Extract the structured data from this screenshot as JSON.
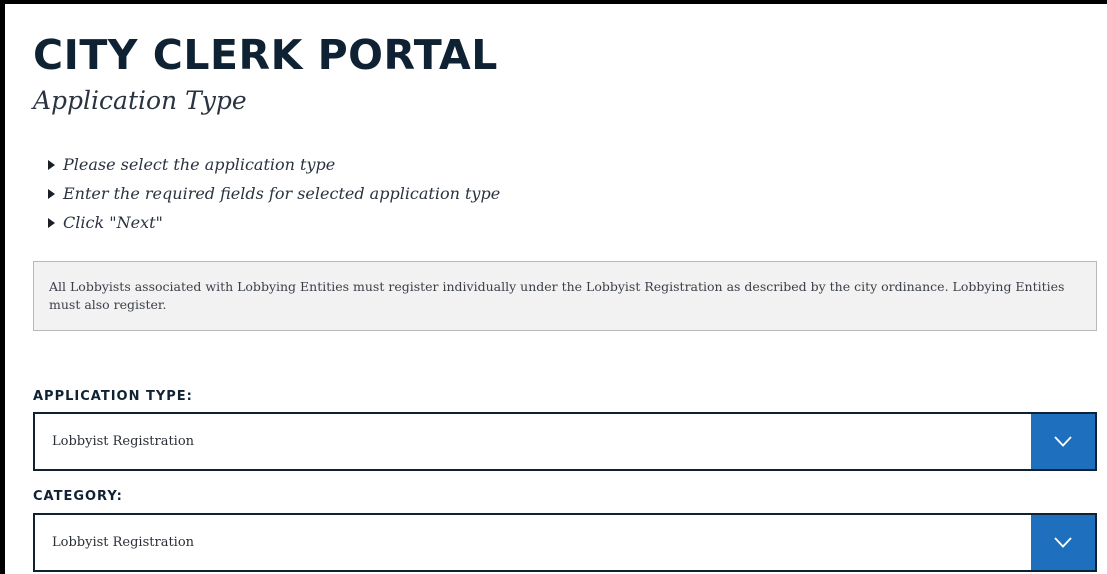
{
  "header": {
    "title": "CITY CLERK PORTAL",
    "subtitle": "Application Type"
  },
  "instructions": [
    "Please select the application type",
    "Enter the required fields for selected application type",
    "Click \"Next\""
  ],
  "notice": {
    "text": "All Lobbyists associated with Lobbying Entities must register individually under the Lobbyist Registration as described by the city ordinance. Lobbying Entities must also register."
  },
  "form": {
    "application_type": {
      "label": "APPLICATION TYPE:",
      "selected": "Lobbyist Registration"
    },
    "category": {
      "label": "CATEGORY:",
      "selected": "Lobbyist Registration"
    }
  },
  "colors": {
    "navy": "#0f2234",
    "accent_blue": "#1f6fbf",
    "notice_bg": "#f2f2f2"
  },
  "icons": {
    "bullet": "triangle-right-icon",
    "dropdown": "chevron-down-icon"
  }
}
